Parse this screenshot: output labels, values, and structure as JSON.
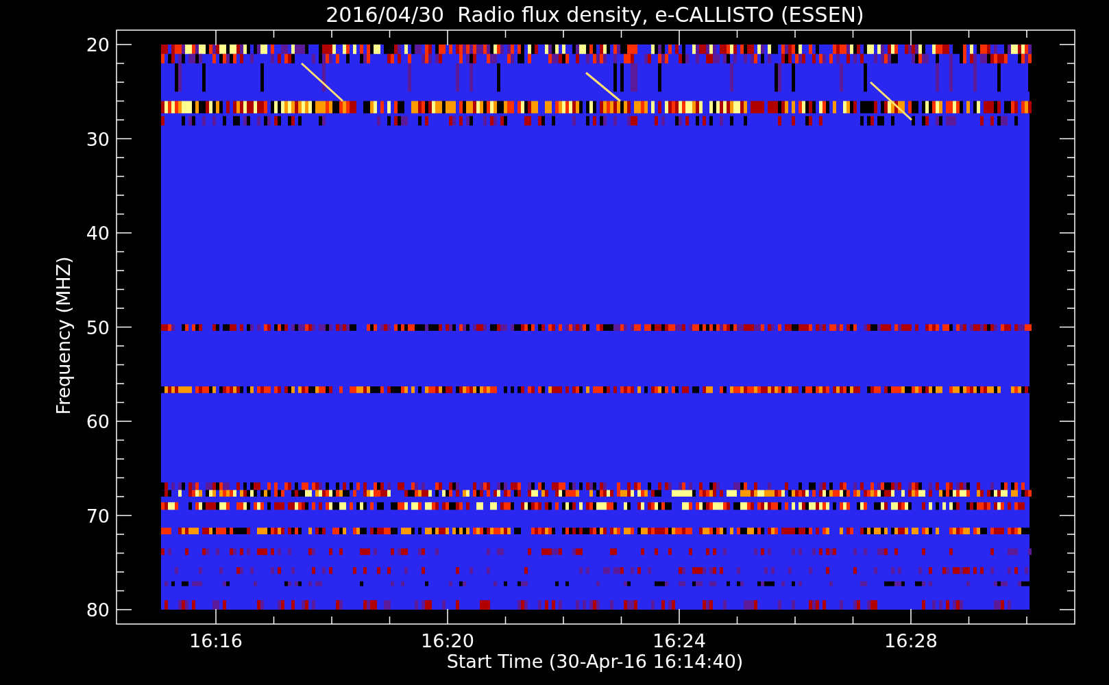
{
  "title": "2016/04/30  Radio flux density, e-CALLISTO (ESSEN)",
  "y_axis": {
    "label": "Frequency (MHZ)",
    "ticks": [
      "20",
      "30",
      "40",
      "50",
      "60",
      "70",
      "80"
    ]
  },
  "x_axis": {
    "label": "Start Time (30-Apr-16 16:14:40)",
    "ticks": [
      "16:16",
      "16:20",
      "16:24",
      "16:28"
    ]
  }
}
